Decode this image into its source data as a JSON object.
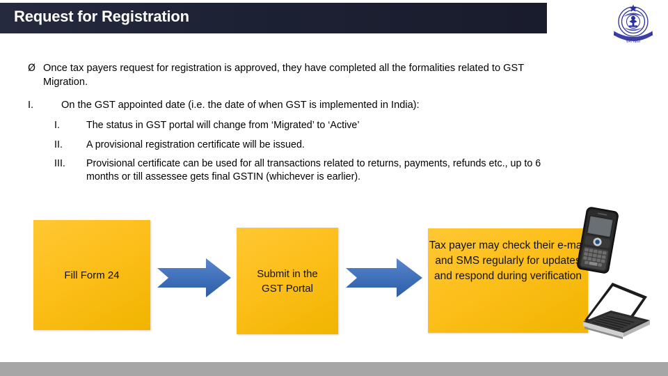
{
  "slide": {
    "title": "Request for Registration",
    "title_bar_color": "#1d2134",
    "footer_bar_color": "#a6a6a6",
    "background_color": "#ffffff"
  },
  "logo": {
    "name": "cbec-government-emblem",
    "color": "#2a2f9e"
  },
  "content": {
    "bullet": {
      "marker": "Ø",
      "text": "Once tax payers request for registration is approved, they have completed all the formalities related to GST Migration."
    },
    "level1": {
      "number": "I.",
      "text": "On the GST appointed date (i.e. the date of when GST is implemented in India):"
    },
    "sub_items": [
      {
        "number": "I.",
        "text": "The status in GST portal will change from ‘Migrated’ to ‘Active’"
      },
      {
        "number": "II.",
        "text": "A provisional registration certificate will be issued."
      },
      {
        "number": "III.",
        "text": "Provisional certificate can be used for all transactions related to returns, payments, refunds etc., up to 6 months or till assessee gets final GSTIN (whichever is earlier)."
      }
    ]
  },
  "flow": {
    "box_fill": "#fcbe19",
    "arrow_fill": "#3d6fb8",
    "steps": [
      {
        "label": "Fill Form 24"
      },
      {
        "label": "Submit in the\nGST Portal"
      },
      {
        "label": "Tax payer may check their e-mail and SMS regularly for updates and respond during verification"
      }
    ],
    "arrows": [
      {
        "name": "arrow-step-1-to-2"
      },
      {
        "name": "arrow-step-2-to-3"
      }
    ]
  },
  "decorations": {
    "phone": "smartphone-image",
    "laptop": "laptop-image"
  }
}
